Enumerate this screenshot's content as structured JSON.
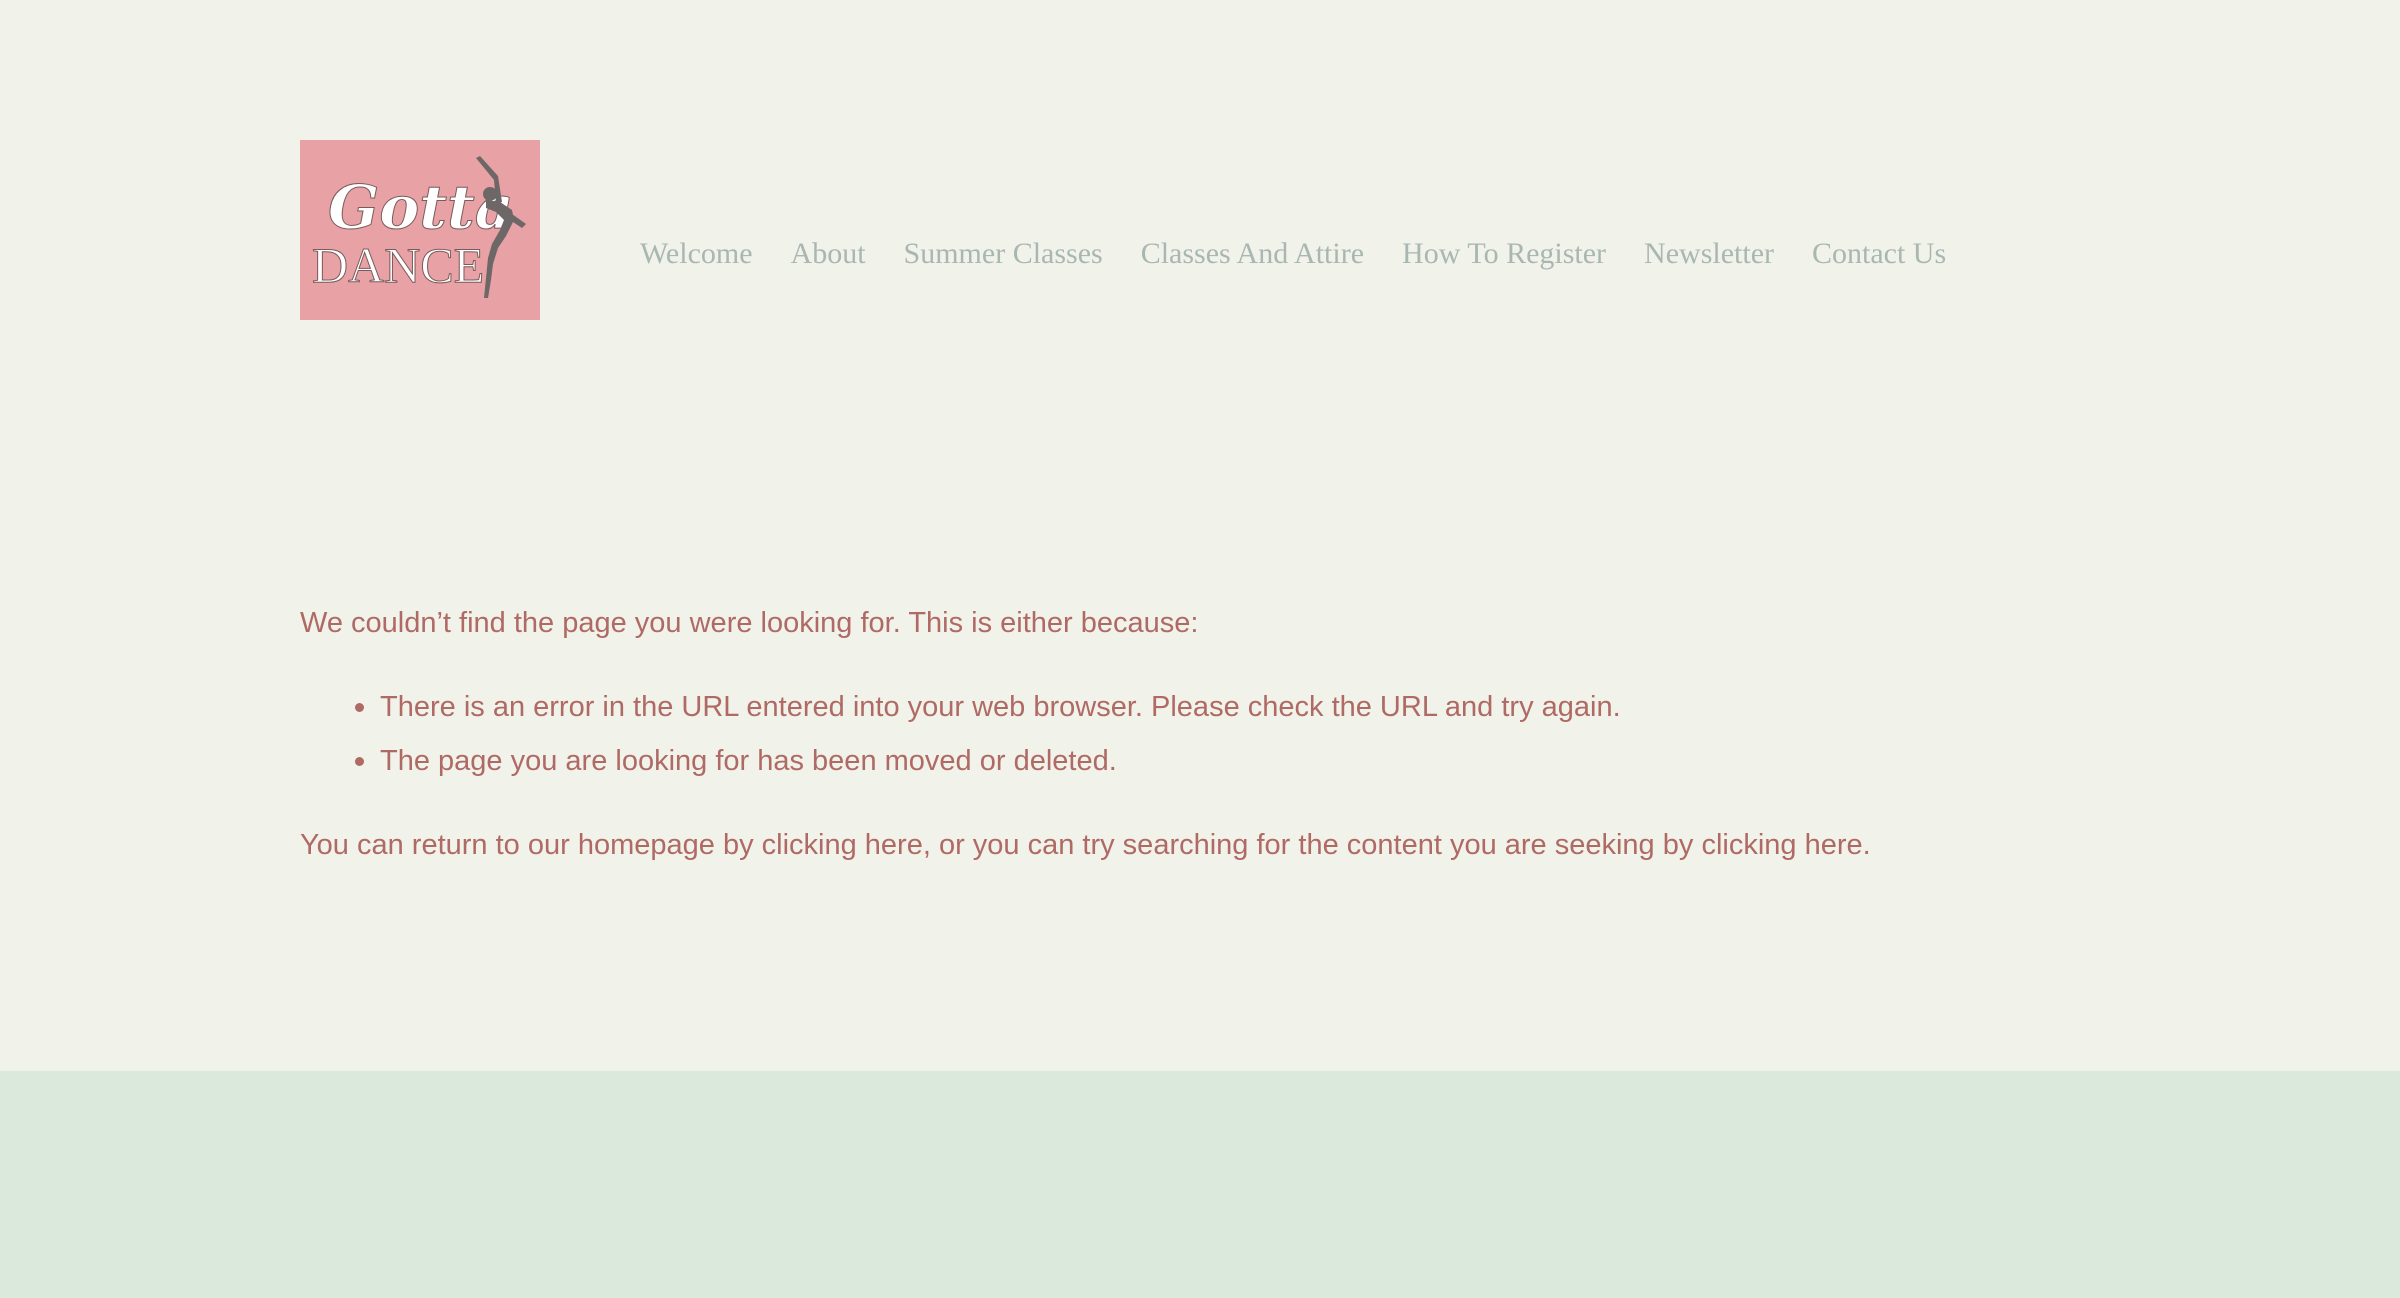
{
  "logo": {
    "line1": "Gotta",
    "line2": "DANCE",
    "background_color": "#e8a1a5",
    "icon": "dancer-silhouette-icon"
  },
  "nav": {
    "items": [
      {
        "label": "Welcome"
      },
      {
        "label": "About"
      },
      {
        "label": "Summer Classes"
      },
      {
        "label": "Classes And Attire"
      },
      {
        "label": "How To Register"
      },
      {
        "label": "Newsletter"
      },
      {
        "label": "Contact Us"
      }
    ],
    "text_color": "#a9b7b2"
  },
  "main": {
    "intro": "We couldn’t find the page you were looking for. This is either because:",
    "reasons": [
      "There is an error in the URL entered into your web browser. Please check the URL and try again.",
      "The page you are looking for has been moved or deleted."
    ],
    "return_prefix": "You can return to our homepage by ",
    "return_link": "clicking here",
    "return_middle": ", or you can try searching for the content you are seeking by ",
    "search_link": "clicking here",
    "return_suffix": ".",
    "text_color": "#b06a65"
  },
  "colors": {
    "page_background": "#f1f2e9",
    "footer_background": "#dbe8dc"
  }
}
